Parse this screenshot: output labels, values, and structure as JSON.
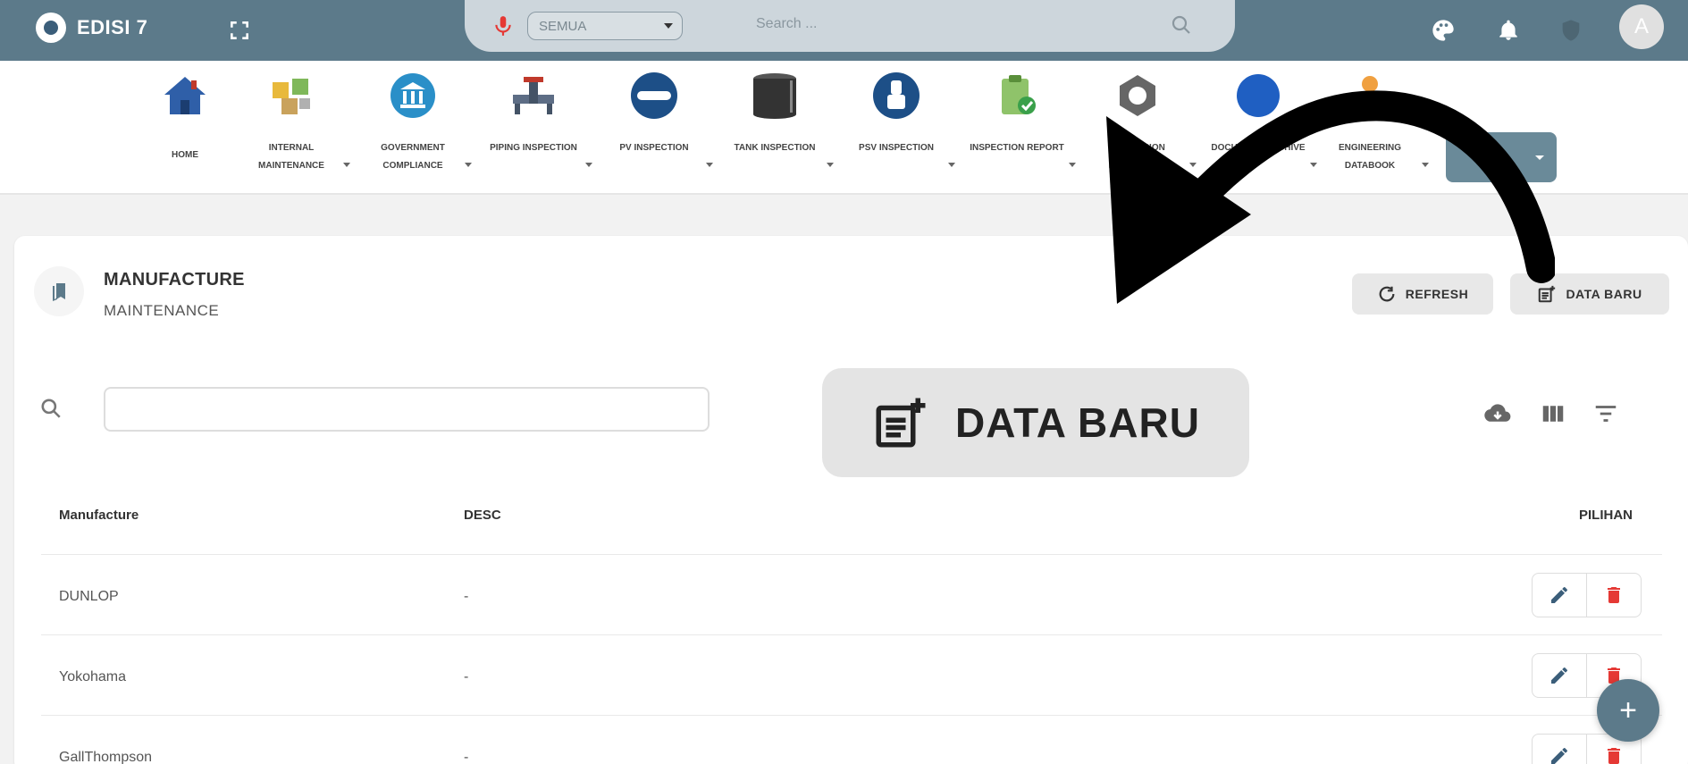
{
  "app": {
    "brand": "EDISI 7"
  },
  "search": {
    "scope": "SEMUA",
    "placeholder": "Search ..."
  },
  "user": {
    "avatar_letter": "A"
  },
  "menu": {
    "items": [
      {
        "label": "HOME",
        "icon": "home-icon"
      },
      {
        "label": "INTERNAL MAINTENANCE",
        "icon": "boxes-icon"
      },
      {
        "label": "GOVERNMENT COMPLIANCE",
        "icon": "bank-icon"
      },
      {
        "label": "PIPING INSPECTION",
        "icon": "pipe-valve-icon"
      },
      {
        "label": "PV INSPECTION",
        "icon": "pressure-vessel-icon"
      },
      {
        "label": "TANK INSPECTION",
        "icon": "tank-icon"
      },
      {
        "label": "PSV INSPECTION",
        "icon": "psv-icon"
      },
      {
        "label": "INSPECTION REPORT",
        "icon": "clipboard-check-icon"
      },
      {
        "label": "CORROSION MONITORING",
        "icon": "nut-icon"
      },
      {
        "label": "DOCUMENT ARCHIVE",
        "icon": "globe-icon"
      },
      {
        "label": "ENGINEERING DATABOOK",
        "icon": "engineer-icon"
      }
    ]
  },
  "page": {
    "title": "MANUFACTURE",
    "subtitle": "MAINTENANCE"
  },
  "buttons": {
    "refresh": "REFRESH",
    "new": "DATA BARU"
  },
  "table": {
    "headers": {
      "manufacture": "Manufacture",
      "desc": "DESC",
      "options": "PILIHAN"
    },
    "rows": [
      {
        "manufacture": "DUNLOP",
        "desc": "-"
      },
      {
        "manufacture": "Yokohama",
        "desc": "-"
      },
      {
        "manufacture": "GallThompson",
        "desc": "-"
      }
    ]
  },
  "callout": {
    "label": "DATA BARU"
  },
  "colors": {
    "topbar": "#5c7a8a",
    "delete": "#e53935",
    "accent": "#3b5e7a"
  }
}
